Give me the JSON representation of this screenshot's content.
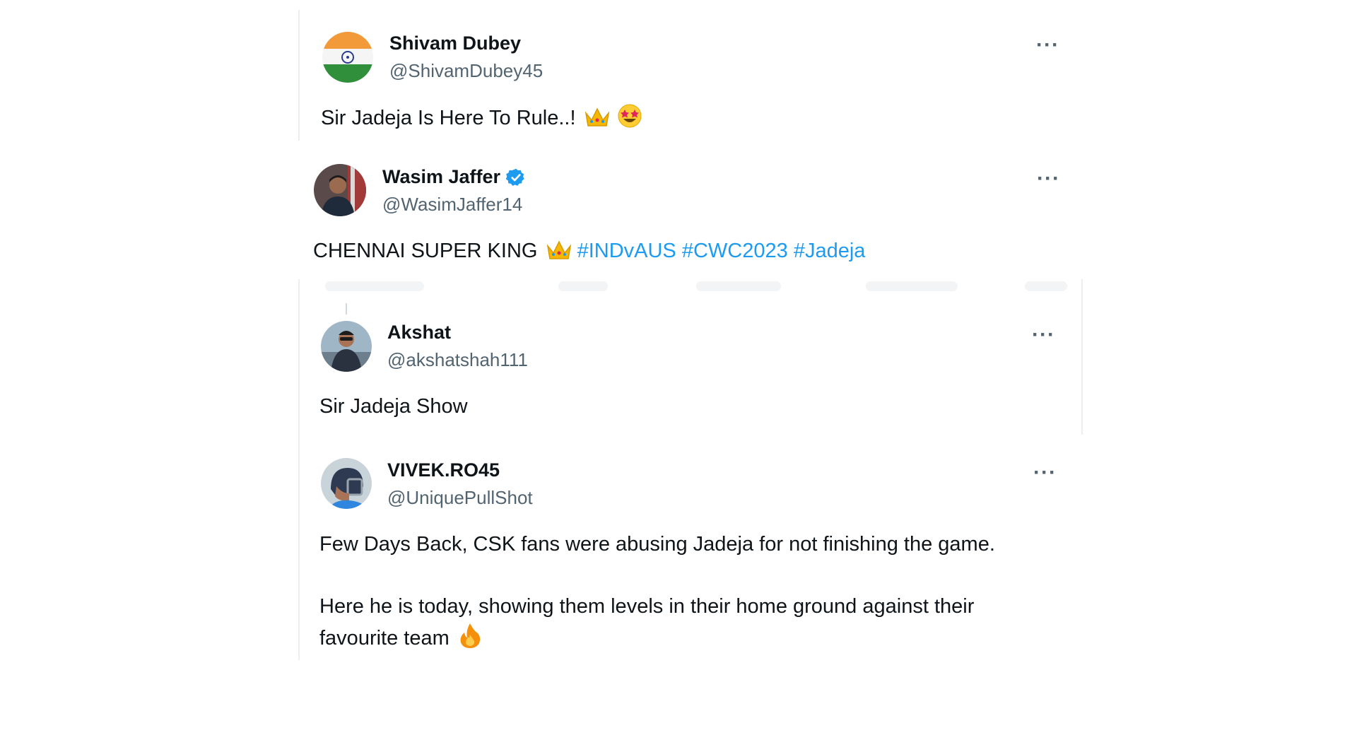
{
  "tweets": [
    {
      "name": "Shivam Dubey",
      "handle": "@ShivamDubey45",
      "text": "Sir Jadeja Is Here To Rule..!",
      "emojis": [
        "crown-emoji",
        "star-struck-emoji"
      ],
      "more": "···"
    },
    {
      "name": "Wasim Jaffer",
      "verified": true,
      "handle": "@WasimJaffer14",
      "text": "CHENNAI SUPER KING",
      "emojis": [
        "crown-emoji"
      ],
      "hashtags": [
        "#INDvAUS",
        "#CWC2023",
        "#Jadeja"
      ],
      "more": "···"
    },
    {
      "name": "Akshat",
      "handle": "@akshatshah111",
      "text": "Sir Jadeja Show",
      "more": "···"
    },
    {
      "name": "VIVEK.RO45",
      "handle": "@UniquePullShot",
      "text_line1": "Few Days Back, CSK fans were abusing Jadeja for not finishing the game.",
      "text_line2": "Here he is today, showing them levels in their home ground against their",
      "text_line3": "favourite team",
      "emojis": [
        "fire-emoji"
      ],
      "more": "···"
    }
  ],
  "colors": {
    "text": "#0f1419",
    "secondary": "#536471",
    "link": "#1d9bf0",
    "verified": "#1d9bf0",
    "divider": "#eceff1"
  }
}
